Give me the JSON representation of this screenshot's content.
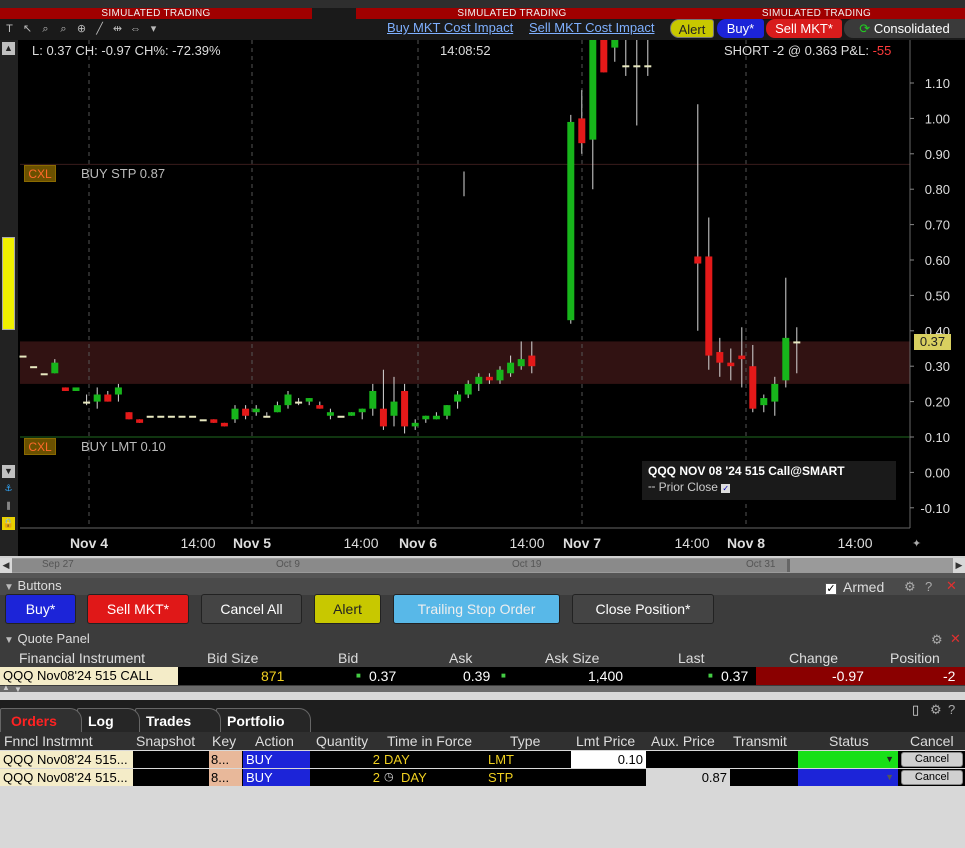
{
  "banner": {
    "simulated": "SIMULATED TRADING"
  },
  "top_links": {
    "buy_cost": "Buy MKT Cost Impact",
    "sell_cost": "Sell MKT Cost Impact"
  },
  "top_pills": {
    "alert": "Alert",
    "buy": "Buy*",
    "sell": "Sell MKT*",
    "consolidated": "Consolidated"
  },
  "chart_info": {
    "ohlc": "L: 0.37 CH: -0.97 CH%: -72.39%",
    "clock": "14:08:52",
    "position": "SHORT -2 @ 0.363 P&L:",
    "pnl": "-55",
    "last_tag": "0.37"
  },
  "order_lines": [
    {
      "cxl": "CXL",
      "label": "BUY STP 0.87"
    },
    {
      "cxl": "CXL",
      "label": "BUY LMT 0.10"
    }
  ],
  "legend": {
    "title": "QQQ NOV 08 '24 515 Call@SMART",
    "prior": "Prior Close"
  },
  "colors": {
    "up": "#17b51b",
    "down": "#e41919",
    "stp_line": "#3a1c1c",
    "lmt_line": "#1f6a1f",
    "band": "#3a1515"
  },
  "chart_data": {
    "type": "candlestick",
    "y_axis": {
      "min": -0.12,
      "max": 1.25,
      "ticks": [
        1.1,
        1.0,
        0.9,
        0.8,
        0.7,
        0.6,
        0.5,
        0.4,
        0.3,
        0.2,
        0.1,
        0.0,
        -0.1
      ]
    },
    "x_tick_labels": [
      "Nov 4",
      "14:00",
      "Nov 5",
      "14:00",
      "Nov 6",
      "14:00",
      "Nov 7",
      "14:00",
      "Nov 8",
      "14:00"
    ],
    "day_separators": [
      "Nov 4",
      "Nov 5",
      "Nov 6",
      "Nov 7",
      "Nov 8"
    ],
    "stop_order_price": 0.87,
    "limit_order_price": 0.1,
    "candles": [
      {
        "o": 0.33,
        "h": 0.33,
        "l": 0.33,
        "c": 0.33
      },
      {
        "o": 0.3,
        "h": 0.3,
        "l": 0.3,
        "c": 0.3
      },
      {
        "o": 0.28,
        "h": 0.28,
        "l": 0.28,
        "c": 0.28
      },
      {
        "o": 0.28,
        "h": 0.32,
        "l": 0.28,
        "c": 0.31
      },
      {
        "o": 0.24,
        "h": 0.24,
        "l": 0.23,
        "c": 0.23
      },
      {
        "o": 0.23,
        "h": 0.24,
        "l": 0.23,
        "c": 0.24
      },
      {
        "o": 0.2,
        "h": 0.22,
        "l": 0.19,
        "c": 0.2
      },
      {
        "o": 0.2,
        "h": 0.24,
        "l": 0.18,
        "c": 0.22
      },
      {
        "o": 0.22,
        "h": 0.23,
        "l": 0.2,
        "c": 0.2
      },
      {
        "o": 0.22,
        "h": 0.25,
        "l": 0.2,
        "c": 0.24
      },
      {
        "o": 0.17,
        "h": 0.17,
        "l": 0.15,
        "c": 0.15
      },
      {
        "o": 0.15,
        "h": 0.15,
        "l": 0.14,
        "c": 0.14
      },
      {
        "o": 0.16,
        "h": 0.16,
        "l": 0.16,
        "c": 0.16
      },
      {
        "o": 0.16,
        "h": 0.16,
        "l": 0.16,
        "c": 0.16
      },
      {
        "o": 0.16,
        "h": 0.16,
        "l": 0.16,
        "c": 0.16
      },
      {
        "o": 0.16,
        "h": 0.16,
        "l": 0.16,
        "c": 0.16
      },
      {
        "o": 0.16,
        "h": 0.16,
        "l": 0.16,
        "c": 0.16
      },
      {
        "o": 0.15,
        "h": 0.15,
        "l": 0.15,
        "c": 0.15
      },
      {
        "o": 0.15,
        "h": 0.15,
        "l": 0.14,
        "c": 0.14
      },
      {
        "o": 0.14,
        "h": 0.14,
        "l": 0.13,
        "c": 0.13
      },
      {
        "o": 0.15,
        "h": 0.19,
        "l": 0.14,
        "c": 0.18
      },
      {
        "o": 0.18,
        "h": 0.19,
        "l": 0.15,
        "c": 0.16
      },
      {
        "o": 0.17,
        "h": 0.19,
        "l": 0.16,
        "c": 0.18
      },
      {
        "o": 0.16,
        "h": 0.17,
        "l": 0.16,
        "c": 0.16
      },
      {
        "o": 0.17,
        "h": 0.2,
        "l": 0.17,
        "c": 0.19
      },
      {
        "o": 0.19,
        "h": 0.23,
        "l": 0.18,
        "c": 0.22
      },
      {
        "o": 0.2,
        "h": 0.21,
        "l": 0.19,
        "c": 0.2
      },
      {
        "o": 0.2,
        "h": 0.21,
        "l": 0.19,
        "c": 0.21
      },
      {
        "o": 0.19,
        "h": 0.2,
        "l": 0.18,
        "c": 0.18
      },
      {
        "o": 0.16,
        "h": 0.18,
        "l": 0.15,
        "c": 0.17
      },
      {
        "o": 0.16,
        "h": 0.16,
        "l": 0.16,
        "c": 0.16
      },
      {
        "o": 0.16,
        "h": 0.17,
        "l": 0.16,
        "c": 0.17
      },
      {
        "o": 0.17,
        "h": 0.18,
        "l": 0.15,
        "c": 0.18
      },
      {
        "o": 0.18,
        "h": 0.25,
        "l": 0.16,
        "c": 0.23
      },
      {
        "o": 0.18,
        "h": 0.29,
        "l": 0.12,
        "c": 0.13
      },
      {
        "o": 0.16,
        "h": 0.27,
        "l": 0.13,
        "c": 0.2
      },
      {
        "o": 0.23,
        "h": 0.25,
        "l": 0.11,
        "c": 0.13
      },
      {
        "o": 0.13,
        "h": 0.15,
        "l": 0.12,
        "c": 0.14
      },
      {
        "o": 0.15,
        "h": 0.16,
        "l": 0.14,
        "c": 0.16
      },
      {
        "o": 0.15,
        "h": 0.17,
        "l": 0.15,
        "c": 0.16
      },
      {
        "o": 0.16,
        "h": 0.19,
        "l": 0.15,
        "c": 0.19
      },
      {
        "o": 0.2,
        "h": 0.23,
        "l": 0.18,
        "c": 0.22
      },
      {
        "o": 0.22,
        "h": 0.26,
        "l": 0.21,
        "c": 0.25
      },
      {
        "o": 0.25,
        "h": 0.28,
        "l": 0.23,
        "c": 0.27
      },
      {
        "o": 0.27,
        "h": 0.28,
        "l": 0.25,
        "c": 0.26
      },
      {
        "o": 0.26,
        "h": 0.3,
        "l": 0.25,
        "c": 0.29
      },
      {
        "o": 0.28,
        "h": 0.33,
        "l": 0.27,
        "c": 0.31
      },
      {
        "o": 0.3,
        "h": 0.37,
        "l": 0.29,
        "c": 0.32
      },
      {
        "o": 0.33,
        "h": 0.37,
        "l": 0.28,
        "c": 0.3
      },
      {
        "o": 0.43,
        "h": 1.01,
        "l": 0.42,
        "c": 0.99
      },
      {
        "o": 1.0,
        "h": 1.08,
        "l": 0.9,
        "c": 0.93
      },
      {
        "o": 0.94,
        "h": 1.25,
        "l": 0.8,
        "c": 1.25
      },
      {
        "o": 1.25,
        "h": 1.25,
        "l": 1.13,
        "c": 1.13
      },
      {
        "o": 1.2,
        "h": 1.25,
        "l": 1.16,
        "c": 1.25
      },
      {
        "o": 1.15,
        "h": 1.25,
        "l": 1.12,
        "c": 1.15
      },
      {
        "o": 1.15,
        "h": 1.25,
        "l": 0.98,
        "c": 1.15
      },
      {
        "o": 1.15,
        "h": 1.25,
        "l": 1.12,
        "c": 1.15
      },
      {
        "o": 0.61,
        "h": 1.04,
        "l": 0.4,
        "c": 0.59
      },
      {
        "o": 0.61,
        "h": 0.72,
        "l": 0.29,
        "c": 0.33
      },
      {
        "o": 0.34,
        "h": 0.38,
        "l": 0.27,
        "c": 0.31
      },
      {
        "o": 0.31,
        "h": 0.35,
        "l": 0.26,
        "c": 0.3
      },
      {
        "o": 0.33,
        "h": 0.41,
        "l": 0.24,
        "c": 0.32
      },
      {
        "o": 0.3,
        "h": 0.36,
        "l": 0.17,
        "c": 0.18
      },
      {
        "o": 0.19,
        "h": 0.22,
        "l": 0.17,
        "c": 0.21
      },
      {
        "o": 0.2,
        "h": 0.27,
        "l": 0.16,
        "c": 0.25
      },
      {
        "o": 0.26,
        "h": 0.55,
        "l": 0.24,
        "c": 0.38
      },
      {
        "o": 0.37,
        "h": 0.41,
        "l": 0.28,
        "c": 0.37
      }
    ]
  },
  "scroll_labels": [
    "Sep 27",
    "Oct 9",
    "Oct 19",
    "Oct 31"
  ],
  "buttons_panel": {
    "title": "Buttons",
    "armed": "Armed",
    "armed_check": "✓",
    "buy": "Buy*",
    "sell": "Sell MKT*",
    "cancel_all": "Cancel All",
    "alert": "Alert",
    "trailing_stop": "Trailing Stop Order",
    "close_position": "Close Position*"
  },
  "quote_panel": {
    "title": "Quote Panel",
    "headers": [
      "Financial Instrument",
      "Bid Size",
      "Bid",
      "Ask",
      "Ask Size",
      "Last",
      "Change",
      "Position"
    ],
    "row": {
      "instrument": "QQQ Nov08'24 515 CALL",
      "bid_size": "871",
      "bid": "0.37",
      "ask": "0.39",
      "ask_size": "1,400",
      "last": "0.37",
      "change": "-0.97",
      "position": "-2"
    }
  },
  "orders": {
    "tabs": [
      "Orders",
      "Log",
      "Trades",
      "Portfolio"
    ],
    "headers": [
      "Fnncl Instrmnt",
      "Snapshot",
      "Key",
      "Action",
      "Quantity",
      "Time in Force",
      "Type",
      "Lmt Price",
      "Aux. Price",
      "Transmit",
      "Status",
      "Cancel"
    ],
    "rows": [
      {
        "instrument": "QQQ Nov08'24 515...",
        "key": "8...",
        "action": "BUY",
        "quantity": "2",
        "tif": "DAY",
        "type": "LMT",
        "lmt_price": "0.10",
        "aux_price": "",
        "status_color": "#18e018",
        "cancel": "Cancel"
      },
      {
        "instrument": "QQQ Nov08'24 515...",
        "key": "8...",
        "action": "BUY",
        "quantity": "2",
        "tif": "DAY",
        "type": "STP",
        "lmt_price": "",
        "aux_price": "0.87",
        "status_color": "#1c24d8",
        "cancel": "Cancel"
      }
    ]
  }
}
